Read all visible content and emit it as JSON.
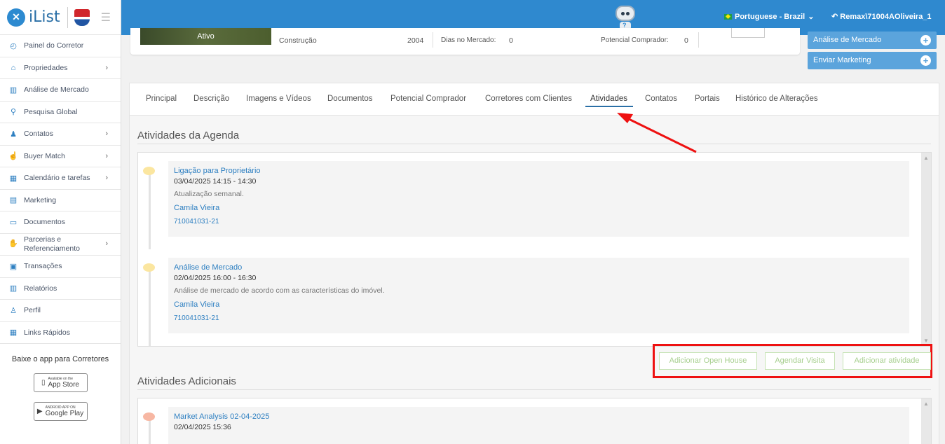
{
  "app": {
    "logo_text": "iList",
    "logo_mark": "✕",
    "remax_alt": "RE/MAX"
  },
  "sidebar": {
    "items": [
      {
        "label": "Painel do Corretor",
        "icon": "gauge-icon",
        "glyph": "◴",
        "chevron": false
      },
      {
        "label": "Propriedades",
        "icon": "home-icon",
        "glyph": "⌂",
        "chevron": true
      },
      {
        "label": "Análise de Mercado",
        "icon": "bar-chart-icon",
        "glyph": "▥",
        "chevron": false
      },
      {
        "label": "Pesquisa Global",
        "icon": "search-icon",
        "glyph": "⚲",
        "chevron": false
      },
      {
        "label": "Contatos",
        "icon": "contacts-icon",
        "glyph": "♟",
        "chevron": true
      },
      {
        "label": "Buyer Match",
        "icon": "hand-pointer-icon",
        "glyph": "☝",
        "chevron": true
      },
      {
        "label": "Calendário e tarefas",
        "icon": "calendar-icon",
        "glyph": "▦",
        "chevron": true
      },
      {
        "label": "Marketing",
        "icon": "newspaper-icon",
        "glyph": "▤",
        "chevron": false
      },
      {
        "label": "Documentos",
        "icon": "folder-icon",
        "glyph": "▭",
        "chevron": false
      },
      {
        "label": "Parcerias e Referenciamento",
        "icon": "handshake-icon",
        "glyph": "✋",
        "chevron": true
      },
      {
        "label": "Transações",
        "icon": "briefcase-icon",
        "glyph": "▣",
        "chevron": false
      },
      {
        "label": "Relatórios",
        "icon": "report-icon",
        "glyph": "▥",
        "chevron": false
      },
      {
        "label": "Perfil",
        "icon": "user-icon",
        "glyph": "♙",
        "chevron": false
      },
      {
        "label": "Links Rápidos",
        "icon": "links-icon",
        "glyph": "▦",
        "chevron": false
      }
    ],
    "app_title": "Baixe o app para Corretores",
    "app_store": {
      "small": "Available on the",
      "big": "App Store"
    },
    "google_play": {
      "small": "ANDROID APP ON",
      "big": "Google Play"
    }
  },
  "topbar": {
    "language": "Portuguese - Brazil",
    "user": "Remax\\71004AOliveira_1",
    "colors": {
      "bar": "#2f89cf"
    }
  },
  "property": {
    "status": "Ativo",
    "construction_label": "Construção",
    "construction_value": "2004",
    "days_label": "Dias no Mercado:",
    "days_value": "0",
    "buyer_label": "Potencial Comprador:",
    "buyer_value": "0"
  },
  "side_actions": {
    "market_analysis": "Análise de Mercado",
    "send_marketing": "Enviar Marketing"
  },
  "tabs": [
    "Principal",
    "Descrição",
    "Imagens e Vídeos",
    "Documentos",
    "Potencial Comprador",
    "Corretores com Clientes",
    "Atividades",
    "Contatos",
    "Portais",
    "Histórico de Alterações"
  ],
  "active_tab": "Atividades",
  "agenda": {
    "title": "Atividades da Agenda",
    "items": [
      {
        "title": "Ligação para Proprietário",
        "date": "03/04/2025 14:15 - 14:30",
        "description": "Atualização semanal.",
        "agent": "Camila Vieira",
        "ref": "710041031-21",
        "dot_color": "#fbe6a0"
      },
      {
        "title": "Análise de Mercado",
        "date": "02/04/2025 16:00 - 16:30",
        "description": "Análise de mercado de acordo com as características do imóvel.",
        "agent": "Camila Vieira",
        "ref": "710041031-21",
        "dot_color": "#fbe6a0"
      }
    ]
  },
  "actions": {
    "open_house": "Adicionar Open House",
    "schedule_visit": "Agendar Visita",
    "add_activity": "Adicionar atividade"
  },
  "additional": {
    "title": "Atividades Adicionais",
    "items": [
      {
        "title": "Market Analysis 02-04-2025",
        "date": "02/04/2025 15:36",
        "dot_color": "#f7b7a3"
      }
    ]
  }
}
